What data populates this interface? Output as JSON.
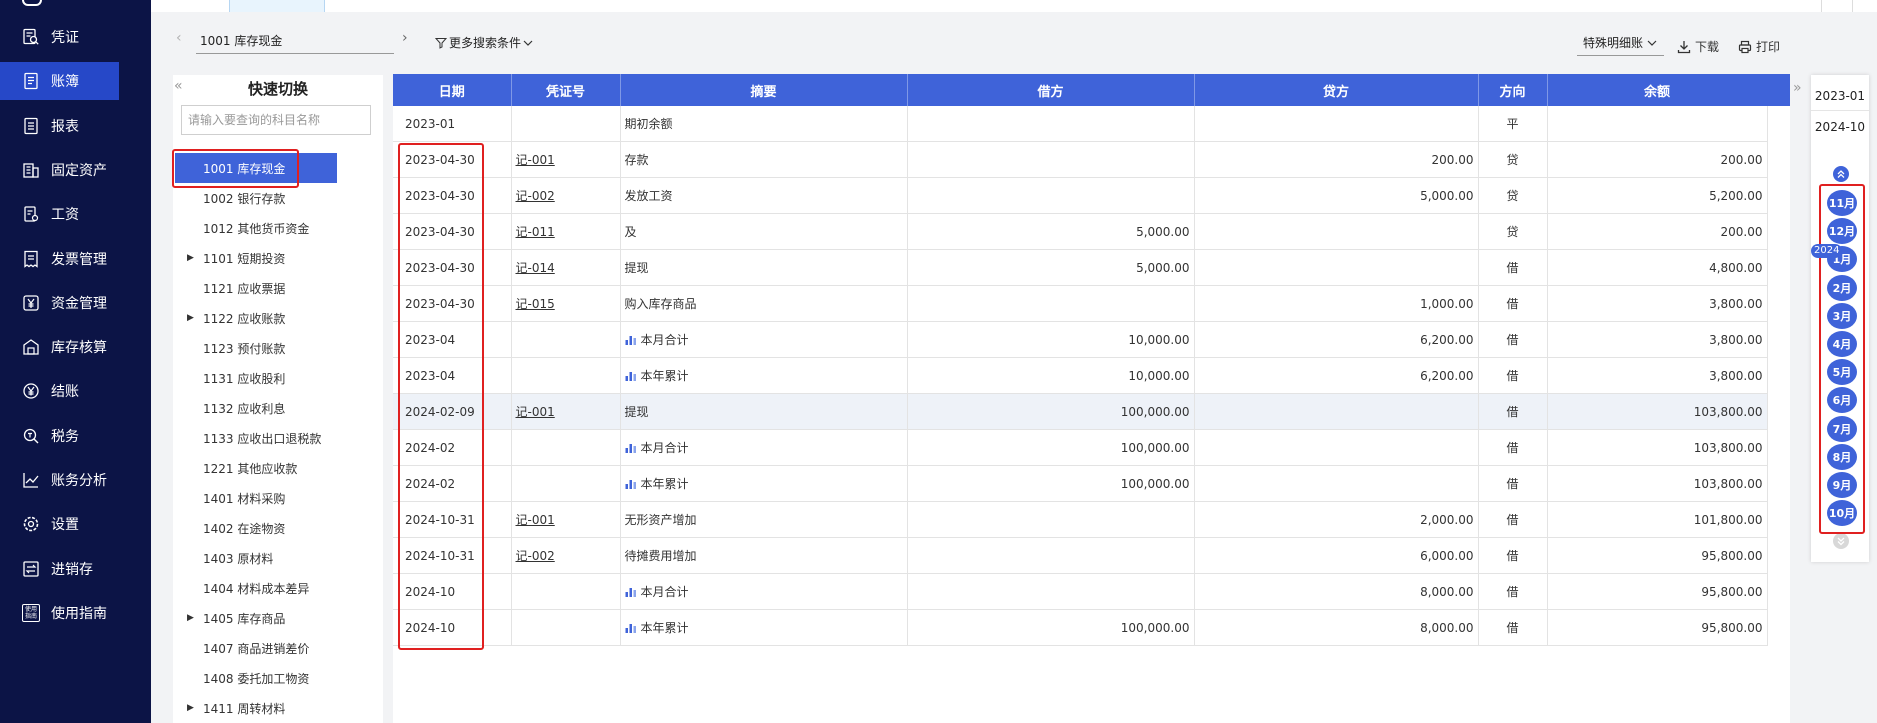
{
  "nav": {
    "items": [
      {
        "label": "凭证",
        "icon": "voucher-search-icon"
      },
      {
        "label": "账簿",
        "icon": "ledger-book-icon"
      },
      {
        "label": "报表",
        "icon": "report-icon"
      },
      {
        "label": "固定资产",
        "icon": "building-icon"
      },
      {
        "label": "工资",
        "icon": "payroll-icon"
      },
      {
        "label": "发票管理",
        "icon": "invoice-icon"
      },
      {
        "label": "资金管理",
        "icon": "yen-box-icon"
      },
      {
        "label": "库存核算",
        "icon": "warehouse-icon"
      },
      {
        "label": "结账",
        "icon": "yen-circle-icon"
      },
      {
        "label": "税务",
        "icon": "tax-search-icon"
      },
      {
        "label": "账务分析",
        "icon": "line-chart-icon"
      },
      {
        "label": "设置",
        "icon": "gear-icon"
      },
      {
        "label": "进销存",
        "icon": "exchange-icon"
      },
      {
        "label": "使用指南",
        "icon": "guide-icon",
        "icon_text": "使用\n指南"
      }
    ],
    "active_index": 1
  },
  "toolbar": {
    "prev_glyph": "‹",
    "next_glyph": "›",
    "subject": "1001  库存现金",
    "more_filter": "更多搜索条件",
    "special_ledger": "特殊明细账",
    "download": "下载",
    "print": "打印"
  },
  "quick_switch": {
    "title": "快速切换",
    "search_placeholder": "请输入要查询的科目名称",
    "collapse_glyph": "«",
    "items": [
      {
        "label": "1001 库存现金",
        "expandable": false,
        "active": true
      },
      {
        "label": "1002 银行存款",
        "expandable": false
      },
      {
        "label": "1012 其他货币资金",
        "expandable": false
      },
      {
        "label": "1101 短期投资",
        "expandable": true
      },
      {
        "label": "1121 应收票据",
        "expandable": false
      },
      {
        "label": "1122 应收账款",
        "expandable": true
      },
      {
        "label": "1123 预付账款",
        "expandable": false
      },
      {
        "label": "1131 应收股利",
        "expandable": false
      },
      {
        "label": "1132 应收利息",
        "expandable": false
      },
      {
        "label": "1133 应收出口退税款",
        "expandable": false
      },
      {
        "label": "1221 其他应收款",
        "expandable": false
      },
      {
        "label": "1401 材料采购",
        "expandable": false
      },
      {
        "label": "1402 在途物资",
        "expandable": false
      },
      {
        "label": "1403 原材料",
        "expandable": false
      },
      {
        "label": "1404 材料成本差异",
        "expandable": false
      },
      {
        "label": "1405 库存商品",
        "expandable": true
      },
      {
        "label": "1407 商品进销差价",
        "expandable": false
      },
      {
        "label": "1408 委托加工物资",
        "expandable": false
      },
      {
        "label": "1411 周转材料",
        "expandable": true
      }
    ]
  },
  "ledger": {
    "columns": [
      "日期",
      "凭证号",
      "摘要",
      "借方",
      "贷方",
      "方向",
      "余额"
    ],
    "rows": [
      {
        "date": "2023-01",
        "voucher": "",
        "summary": "期初余额",
        "debit": "",
        "credit": "",
        "direction": "平",
        "balance": "",
        "subtotal": false
      },
      {
        "date": "2023-04-30",
        "voucher": "记-001",
        "summary": "存款",
        "debit": "",
        "credit": "200.00",
        "direction": "贷",
        "balance": "200.00",
        "subtotal": false
      },
      {
        "date": "2023-04-30",
        "voucher": "记-002",
        "summary": "发放工资",
        "debit": "",
        "credit": "5,000.00",
        "direction": "贷",
        "balance": "5,200.00",
        "subtotal": false
      },
      {
        "date": "2023-04-30",
        "voucher": "记-011",
        "summary": "及",
        "debit": "5,000.00",
        "credit": "",
        "direction": "贷",
        "balance": "200.00",
        "subtotal": false
      },
      {
        "date": "2023-04-30",
        "voucher": "记-014",
        "summary": "提现",
        "debit": "5,000.00",
        "credit": "",
        "direction": "借",
        "balance": "4,800.00",
        "subtotal": false
      },
      {
        "date": "2023-04-30",
        "voucher": "记-015",
        "summary": "购入库存商品",
        "debit": "",
        "credit": "1,000.00",
        "direction": "借",
        "balance": "3,800.00",
        "subtotal": false
      },
      {
        "date": "2023-04",
        "voucher": "",
        "summary": "本月合计",
        "debit": "10,000.00",
        "credit": "6,200.00",
        "direction": "借",
        "balance": "3,800.00",
        "subtotal": true
      },
      {
        "date": "2023-04",
        "voucher": "",
        "summary": "本年累计",
        "debit": "10,000.00",
        "credit": "6,200.00",
        "direction": "借",
        "balance": "3,800.00",
        "subtotal": true
      },
      {
        "date": "2024-02-09",
        "voucher": "记-001",
        "summary": "提现",
        "debit": "100,000.00",
        "credit": "",
        "direction": "借",
        "balance": "103,800.00",
        "subtotal": false,
        "highlight": true
      },
      {
        "date": "2024-02",
        "voucher": "",
        "summary": "本月合计",
        "debit": "100,000.00",
        "credit": "",
        "direction": "借",
        "balance": "103,800.00",
        "subtotal": true
      },
      {
        "date": "2024-02",
        "voucher": "",
        "summary": "本年累计",
        "debit": "100,000.00",
        "credit": "",
        "direction": "借",
        "balance": "103,800.00",
        "subtotal": true
      },
      {
        "date": "2024-10-31",
        "voucher": "记-001",
        "summary": "无形资产增加",
        "debit": "",
        "credit": "2,000.00",
        "direction": "借",
        "balance": "101,800.00",
        "subtotal": false
      },
      {
        "date": "2024-10-31",
        "voucher": "记-002",
        "summary": "待摊费用增加",
        "debit": "",
        "credit": "6,000.00",
        "direction": "借",
        "balance": "95,800.00",
        "subtotal": false
      },
      {
        "date": "2024-10",
        "voucher": "",
        "summary": "本月合计",
        "debit": "",
        "credit": "8,000.00",
        "direction": "借",
        "balance": "95,800.00",
        "subtotal": true
      },
      {
        "date": "2024-10",
        "voucher": "",
        "summary": "本年累计",
        "debit": "100,000.00",
        "credit": "8,000.00",
        "direction": "借",
        "balance": "95,800.00",
        "subtotal": true
      }
    ]
  },
  "timeline": {
    "expand_glyph": "»",
    "start": "2023-01",
    "end": "2024-10",
    "year_badge": "2024",
    "months": [
      "11月",
      "12月",
      "1月",
      "2月",
      "3月",
      "4月",
      "5月",
      "6月",
      "7月",
      "8月",
      "9月",
      "10月"
    ]
  },
  "colors": {
    "nav_bg": "#0c1446",
    "accent": "#3f63d9",
    "highlight_box": "#e02020"
  }
}
